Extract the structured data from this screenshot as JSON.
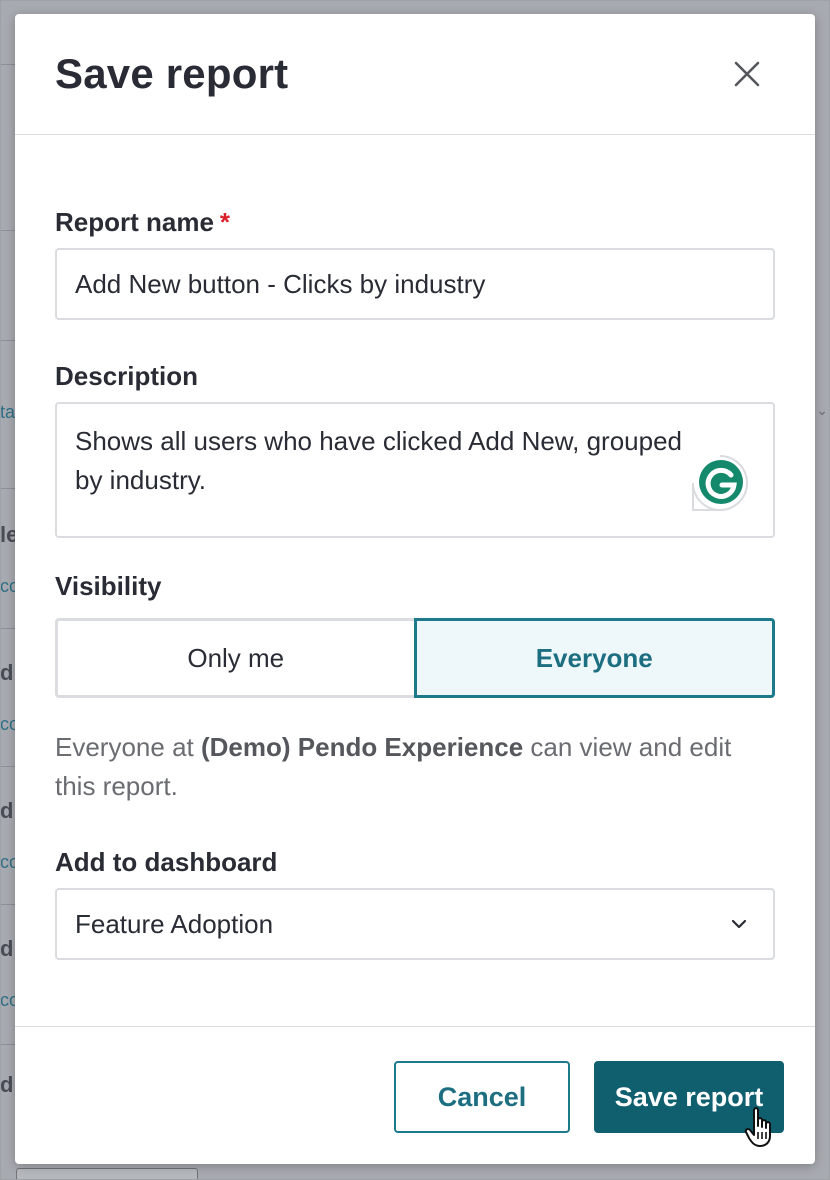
{
  "modal": {
    "title": "Save report",
    "close_icon": "close-icon"
  },
  "report_name": {
    "label": "Report name",
    "required_marker": "*",
    "value": "Add New button - Clicks by industry"
  },
  "description": {
    "label": "Description",
    "value": "Shows all users who have clicked Add New, grouped by industry.",
    "assistant_icon": "grammarly-icon"
  },
  "visibility": {
    "label": "Visibility",
    "options": [
      "Only me",
      "Everyone"
    ],
    "selected": "Everyone",
    "helper_prefix": "Everyone at ",
    "helper_org": "(Demo) Pendo Experience",
    "helper_suffix": " can view and edit this report."
  },
  "dashboard": {
    "label": "Add to dashboard",
    "selected": "Feature Adoption",
    "chevron_icon": "chevron-down-icon"
  },
  "footer": {
    "cancel_label": "Cancel",
    "save_label": "Save report"
  },
  "background": {
    "fragments": [
      "ta",
      "le",
      "co",
      "d",
      "co",
      "d",
      "co",
      "d",
      "co",
      "d"
    ]
  },
  "colors": {
    "accent": "#1c7a8a",
    "primary_button": "#0f5f6e",
    "required": "#db1f2a",
    "selected_bg": "#eef8fa"
  }
}
